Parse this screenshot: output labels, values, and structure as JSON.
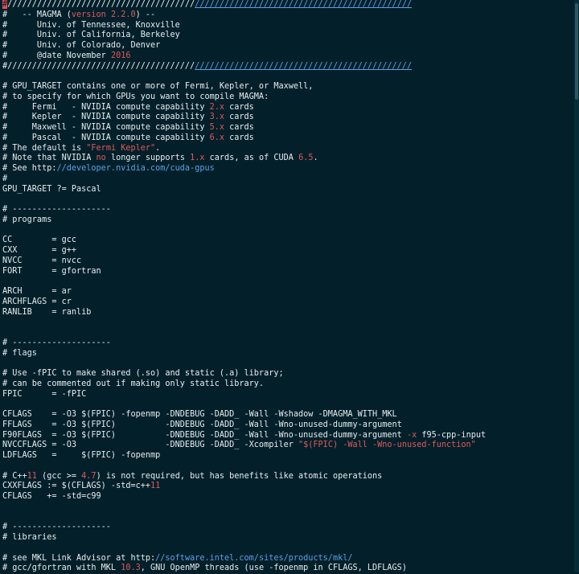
{
  "terminal": {
    "lines": [
      [
        {
          "t": "#",
          "c": "cursor"
        },
        {
          "t": "//////////////////////////////////////",
          "c": ""
        },
        {
          "t": "////////////////////////////////////////////",
          "c": "blue ul"
        }
      ],
      [
        {
          "t": "#   -- MAGMA (",
          "c": ""
        },
        {
          "t": "version 2.2.0",
          "c": "red"
        },
        {
          "t": ") --",
          "c": ""
        }
      ],
      [
        {
          "t": "#      Univ. of Tennessee, Knoxville",
          "c": ""
        }
      ],
      [
        {
          "t": "#      Univ. of California, Berkeley",
          "c": ""
        }
      ],
      [
        {
          "t": "#      Univ. of Colorado, Denver",
          "c": ""
        }
      ],
      [
        {
          "t": "#      @date November ",
          "c": ""
        },
        {
          "t": "2016",
          "c": "red"
        }
      ],
      [
        {
          "t": "#//////////////////////////////////////",
          "c": ""
        },
        {
          "t": "////////////////////////////////////////////",
          "c": "blue ul"
        }
      ],
      [
        {
          "t": "",
          "c": ""
        }
      ],
      [
        {
          "t": "# GPU_TARGET contains one or more of Fermi, Kepler, or Maxwell,",
          "c": ""
        }
      ],
      [
        {
          "t": "# to specify for which GPUs you want to compile MAGMA:",
          "c": ""
        }
      ],
      [
        {
          "t": "#     Fermi   - NVIDIA compute capability ",
          "c": ""
        },
        {
          "t": "2.x",
          "c": "red"
        },
        {
          "t": " cards",
          "c": ""
        }
      ],
      [
        {
          "t": "#     Kepler  - NVIDIA compute capability ",
          "c": ""
        },
        {
          "t": "3.x",
          "c": "red"
        },
        {
          "t": " cards",
          "c": ""
        }
      ],
      [
        {
          "t": "#     Maxwell - NVIDIA compute capability ",
          "c": ""
        },
        {
          "t": "5.x",
          "c": "red"
        },
        {
          "t": " cards",
          "c": ""
        }
      ],
      [
        {
          "t": "#     Pascal  - NVIDIA compute capability ",
          "c": ""
        },
        {
          "t": "6.x",
          "c": "red"
        },
        {
          "t": " cards",
          "c": ""
        }
      ],
      [
        {
          "t": "# The default is ",
          "c": ""
        },
        {
          "t": "\"Fermi Kepler\"",
          "c": "red"
        },
        {
          "t": ".",
          "c": ""
        }
      ],
      [
        {
          "t": "# Note that NVIDIA ",
          "c": ""
        },
        {
          "t": "no",
          "c": "red"
        },
        {
          "t": " longer supports ",
          "c": ""
        },
        {
          "t": "1.x",
          "c": "red"
        },
        {
          "t": " cards, as of CUDA ",
          "c": ""
        },
        {
          "t": "6.5",
          "c": "red"
        },
        {
          "t": ".",
          "c": ""
        }
      ],
      [
        {
          "t": "# See http:",
          "c": ""
        },
        {
          "t": "//developer.nvidia.com/cuda-gpus",
          "c": "blue"
        }
      ],
      [
        {
          "t": "#",
          "c": ""
        }
      ],
      [
        {
          "t": "GPU_TARGET ?= Pascal",
          "c": ""
        }
      ],
      [
        {
          "t": "",
          "c": ""
        }
      ],
      [
        {
          "t": "# --------------------",
          "c": ""
        }
      ],
      [
        {
          "t": "# programs",
          "c": ""
        }
      ],
      [
        {
          "t": "",
          "c": ""
        }
      ],
      [
        {
          "t": "CC        = gcc",
          "c": ""
        }
      ],
      [
        {
          "t": "CXX       = g++",
          "c": ""
        }
      ],
      [
        {
          "t": "NVCC      = nvcc",
          "c": ""
        }
      ],
      [
        {
          "t": "FORT      = gfortran",
          "c": ""
        }
      ],
      [
        {
          "t": "",
          "c": ""
        }
      ],
      [
        {
          "t": "ARCH      = ar",
          "c": ""
        }
      ],
      [
        {
          "t": "ARCHFLAGS = cr",
          "c": ""
        }
      ],
      [
        {
          "t": "RANLIB    = ranlib",
          "c": ""
        }
      ],
      [
        {
          "t": "",
          "c": ""
        }
      ],
      [
        {
          "t": "",
          "c": ""
        }
      ],
      [
        {
          "t": "# --------------------",
          "c": ""
        }
      ],
      [
        {
          "t": "# flags",
          "c": ""
        }
      ],
      [
        {
          "t": "",
          "c": ""
        }
      ],
      [
        {
          "t": "# Use -fPIC to make shared (.so) and static (.a) library;",
          "c": ""
        }
      ],
      [
        {
          "t": "# can be commented out if making only static library.",
          "c": ""
        }
      ],
      [
        {
          "t": "FPIC      = -fPIC",
          "c": ""
        }
      ],
      [
        {
          "t": "",
          "c": ""
        }
      ],
      [
        {
          "t": "CFLAGS    = -O3 $(FPIC) -fopenmp -DNDEBUG -DADD_ -Wall -Wshadow -DMAGMA_WITH_MKL",
          "c": ""
        }
      ],
      [
        {
          "t": "FFLAGS    = -O3 $(FPIC)          -DNDEBUG -DADD_ -Wall -Wno-unused-dummy-argument",
          "c": ""
        }
      ],
      [
        {
          "t": "F90FLAGS  = -O3 $(FPIC)          -DNDEBUG -DADD_ -Wall -Wno-unused-dummy-argument ",
          "c": ""
        },
        {
          "t": "-x",
          "c": "red"
        },
        {
          "t": " f95-cpp-input",
          "c": ""
        }
      ],
      [
        {
          "t": "NVCCFLAGS = -O3                  -DNDEBUG -DADD_ -Xcompiler ",
          "c": ""
        },
        {
          "t": "\"$(FPIC) -Wall -Wno-unused-function\"",
          "c": "red"
        }
      ],
      [
        {
          "t": "LDFLAGS   =     $(FPIC) -fopenmp",
          "c": ""
        }
      ],
      [
        {
          "t": "",
          "c": ""
        }
      ],
      [
        {
          "t": "# C++",
          "c": ""
        },
        {
          "t": "11",
          "c": "red"
        },
        {
          "t": " (gcc >= ",
          "c": ""
        },
        {
          "t": "4.7",
          "c": "red"
        },
        {
          "t": ") is not required, but has benefits like atomic operations",
          "c": ""
        }
      ],
      [
        {
          "t": "CXXFLAGS := $(CFLAGS) -std=c++",
          "c": ""
        },
        {
          "t": "11",
          "c": "red"
        }
      ],
      [
        {
          "t": "CFLAGS   += -std=c99",
          "c": ""
        }
      ],
      [
        {
          "t": "",
          "c": ""
        }
      ],
      [
        {
          "t": "",
          "c": ""
        }
      ],
      [
        {
          "t": "# --------------------",
          "c": ""
        }
      ],
      [
        {
          "t": "# libraries",
          "c": ""
        }
      ],
      [
        {
          "t": "",
          "c": ""
        }
      ],
      [
        {
          "t": "# see MKL Link Advisor at http:",
          "c": ""
        },
        {
          "t": "//software.intel.com/sites/products/mkl/",
          "c": "blue"
        }
      ],
      [
        {
          "t": "# gcc/gfortran with MKL ",
          "c": ""
        },
        {
          "t": "10.3",
          "c": "red"
        },
        {
          "t": ", GNU OpenMP threads (use -fopenmp in CFLAGS, LDFLAGS)",
          "c": ""
        }
      ]
    ]
  },
  "colors": {
    "background": "#03202a",
    "text": "#e6edf0",
    "number": "#e0575a",
    "link": "#5aa0e6"
  }
}
